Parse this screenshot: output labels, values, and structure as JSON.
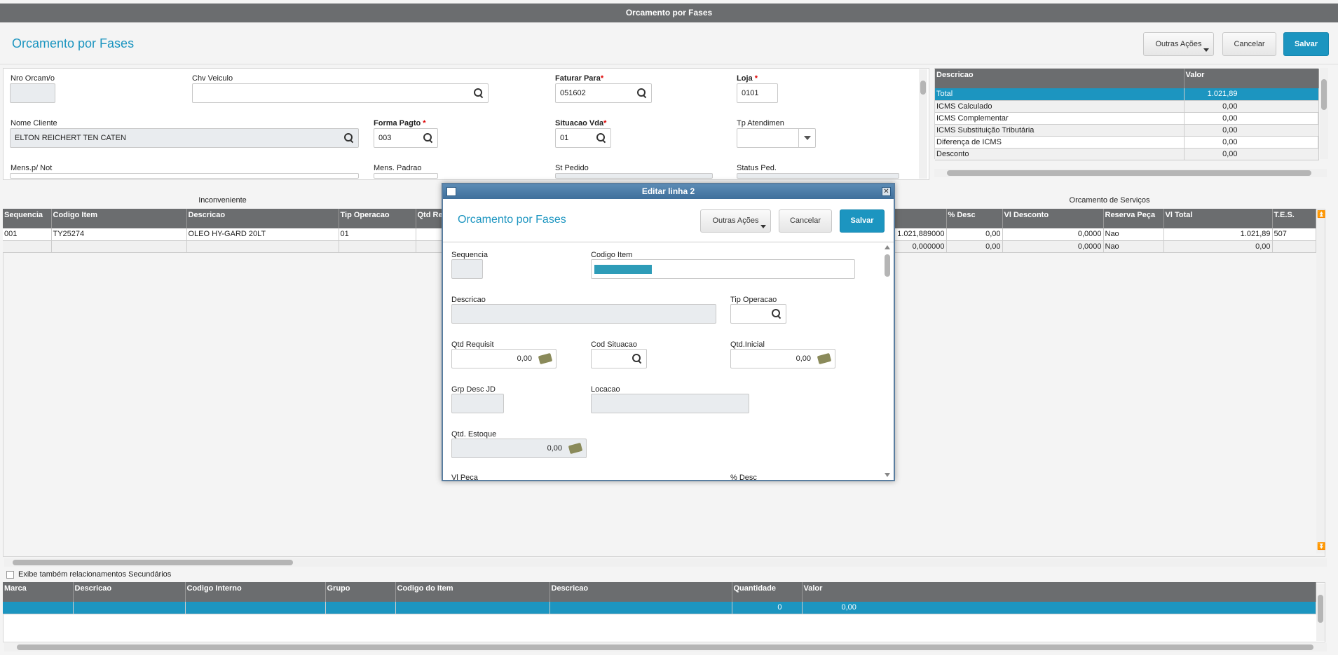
{
  "window": {
    "title": "Orcamento por Fases"
  },
  "header": {
    "title": "Orcamento por Fases",
    "other_actions": "Outras Ações",
    "cancel": "Cancelar",
    "save": "Salvar"
  },
  "form": {
    "nro_orcam_label": "Nro Orcam/o",
    "nro_orcam_value": "",
    "chv_veiculo_label": "Chv Veiculo",
    "chv_veiculo_value": "",
    "faturar_para_label": "Faturar Para",
    "faturar_para_value": "051602",
    "loja_label": "Loja",
    "loja_value": "0101",
    "nome_cliente_label": "Nome Cliente",
    "nome_cliente_value": "ELTON REICHERT TEN CATEN",
    "forma_pagto_label": "Forma Pagto",
    "forma_pagto_value": "003",
    "situacao_vda_label": "Situacao Vda",
    "situacao_vda_value": "01",
    "tp_atendimen_label": "Tp Atendimen",
    "tp_atendimen_value": "",
    "mens_not_label": "Mens.p/ Not",
    "mens_padrao_label": "Mens. Padrao",
    "st_pedido_label": "St Pedido",
    "status_ped_label": "Status Ped.",
    "required_mark": "*"
  },
  "totals": {
    "headers": [
      "Descricao",
      "Valor"
    ],
    "rows": [
      [
        "Total",
        "1.021,89"
      ],
      [
        "ICMS Calculado",
        "0,00"
      ],
      [
        "ICMS Complementar",
        "0,00"
      ],
      [
        "ICMS Substituição Tributária",
        "0,00"
      ],
      [
        "Diferença de ICMS",
        "0,00"
      ],
      [
        "Desconto",
        "0,00"
      ]
    ]
  },
  "sections": {
    "inconveniente": "Inconveniente",
    "orcamento_servicos": "Orcamento de Serviços"
  },
  "items_grid": {
    "left_headers": [
      "Sequencia",
      "Codigo Item",
      "Descricao",
      "Tip Operacao",
      "Qtd Re"
    ],
    "left_rows": [
      [
        "001",
        "TY25274",
        "OLEO HY-GARD 20LT",
        "01",
        ""
      ],
      [
        "",
        "",
        "",
        "",
        ""
      ]
    ],
    "right_headers": [
      "",
      "% Desc",
      "Vl Desconto",
      "Reserva Peça",
      "Vl Total",
      "T.E.S."
    ],
    "right_rows": [
      [
        "1.021,889000",
        "0,00",
        "0,0000",
        "Nao",
        "1.021,89",
        "507"
      ],
      [
        "0,000000",
        "0,00",
        "0,0000",
        "Nao",
        "0,00",
        ""
      ]
    ]
  },
  "bottom": {
    "checkbox_label": "Exibe também relacionamentos Secundários",
    "headers": [
      "Marca",
      "Descricao",
      "Codigo Interno",
      "Grupo",
      "Codigo do Item",
      "Descricao",
      "Quantidade",
      "Valor"
    ],
    "row": [
      "",
      "",
      "",
      "",
      "",
      "",
      "0",
      "0,00"
    ]
  },
  "modal": {
    "title": "Editar linha 2",
    "heading": "Orcamento por Fases",
    "other_actions": "Outras Ações",
    "cancel": "Cancelar",
    "save": "Salvar",
    "sequencia_label": "Sequencia",
    "codigo_item_label": "Codigo Item",
    "descricao_label": "Descricao",
    "tip_operacao_label": "Tip Operacao",
    "qtd_requisit_label": "Qtd Requisit",
    "qtd_requisit_value": "0,00",
    "cod_situacao_label": "Cod Situacao",
    "qtd_inicial_label": "Qtd.Inicial",
    "qtd_inicial_value": "0,00",
    "grp_desc_label": "Grp Desc JD",
    "locacao_label": "Locacao",
    "qtd_estoque_label": "Qtd. Estoque",
    "qtd_estoque_value": "0,00",
    "vl_peca_label": "Vl Peca",
    "pct_desc_label": "% Desc"
  },
  "colors": {
    "accent": "#1c95c0",
    "header_gray": "#6b6d6f"
  }
}
